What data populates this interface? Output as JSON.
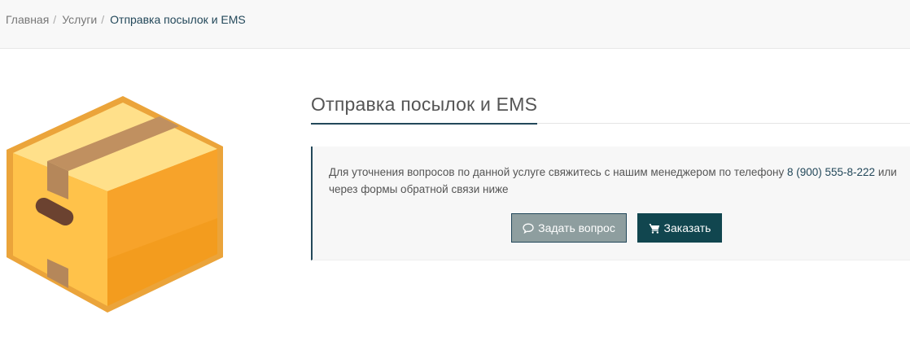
{
  "breadcrumb": {
    "items": [
      "Главная",
      "Услуги"
    ],
    "separator": "/",
    "current": "Отправка посылок и EMS"
  },
  "page": {
    "title": "Отправка посылок и EMS"
  },
  "info": {
    "text_before_phone": "Для уточнения вопросов по данной услуге свяжитесь с нашим менеджером по телефону ",
    "phone": "8 (900) 555-8-222",
    "text_after_phone": " или через формы обратной связи ниже"
  },
  "buttons": {
    "question_label": "Задать вопрос",
    "question_icon": "comment-icon",
    "order_label": "Заказать",
    "order_icon": "cart-icon"
  },
  "illustration": {
    "icon": "cardboard-box-icon"
  },
  "colors": {
    "accent": "#23485a",
    "order_button": "#11464f",
    "question_button": "#8e9e9f",
    "box_light": "#ffd26a",
    "box_dark": "#f2a020",
    "tape": "#b88a5e"
  }
}
